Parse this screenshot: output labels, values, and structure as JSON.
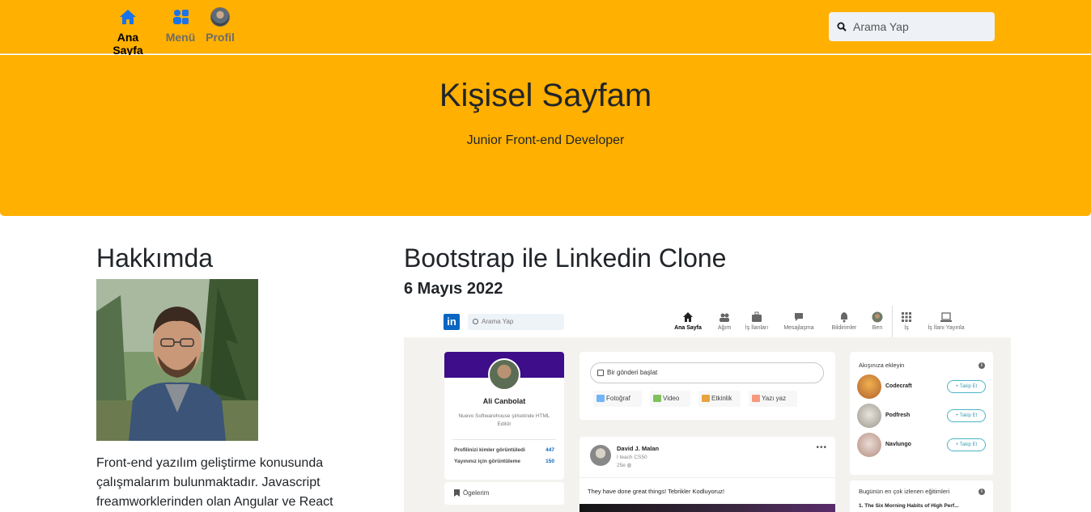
{
  "nav": {
    "home_label": "Ana Sayfa",
    "menu_label": "Menü",
    "profile_label": "Profil",
    "search_placeholder": "Arama Yap",
    "accent_color": "#ffb000",
    "active_icon_color": "#1a73e8"
  },
  "hero": {
    "title": "Kişisel Sayfam",
    "subtitle": "Junior Front-end Developer"
  },
  "about": {
    "title": "Hakkımda",
    "text": "Front-end yazılım geliştirme konusunda çalışmalarım bulunmaktadır. Javascript freamworklerinden olan Angular ve React"
  },
  "post": {
    "title": "Bootstrap ile Linkedin Clone",
    "date": "6 Mayıs 2022",
    "screenshot": {
      "logo": "in",
      "search_placeholder": "Arama Yap",
      "nav": [
        "Ana Sayfa",
        "Ağım",
        "İş İlanları",
        "Mesajlaşma",
        "Bildirimler",
        "Ben",
        "İş",
        "İş İlanı Yayınla"
      ],
      "profile": {
        "name": "Ali Canbolat",
        "subtitle": "Nuevo Softwarehouse şirketinde HTML Editör",
        "stats": [
          {
            "label": "Profilinizi kimler görüntüledi",
            "value": "447"
          },
          {
            "label": "Yayınınız için görüntüleme",
            "value": "150"
          }
        ],
        "saved": "Ögelerim"
      },
      "composer": {
        "placeholder": "Bir gönderi başlat",
        "actions": [
          "Fotoğraf",
          "Video",
          "Etkinlik",
          "Yazı yaz"
        ]
      },
      "feed_post": {
        "author": "David J. Malan",
        "author_sub": "I teach CS50",
        "time": "25e",
        "more": "•••",
        "text": "They have done great things! Tebrikler Kodluyoruz!"
      },
      "suggestions": {
        "title": "Akışınıza ekleyin",
        "follow_label": "+ Takip Et",
        "items": [
          "Codecraft",
          "Podfresh",
          "Navlungo"
        ]
      },
      "courses": {
        "title": "Bugünün en çok izlenen eğitimleri",
        "first": "1. The Six Morning Habits of High Perf..."
      }
    }
  }
}
